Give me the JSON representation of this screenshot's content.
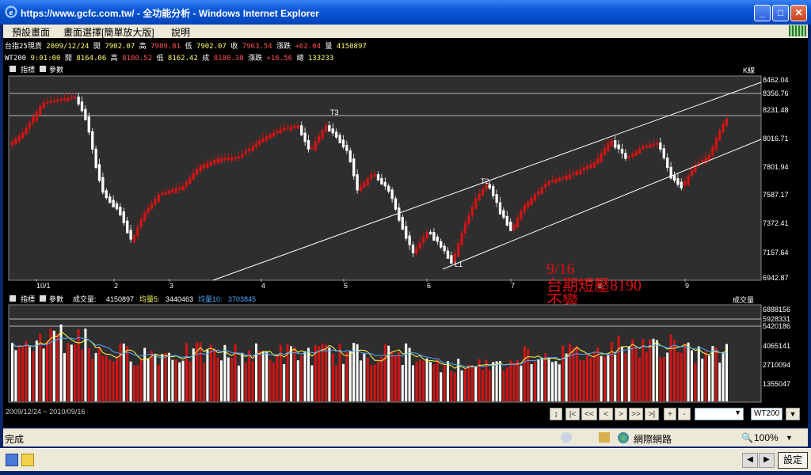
{
  "window": {
    "title": "https://www.gcfc.com.tw/ - 全功能分析 - Windows Internet Explorer",
    "min_label": "_",
    "max_label": "□",
    "close_label": "✕"
  },
  "menu": [
    "預設畫面",
    "畫面選擇[簡單放大版]",
    "說明"
  ],
  "quotes": {
    "row1": {
      "name": "台指25現貨",
      "date": "2009/12/24",
      "open_label": "開",
      "open": "7902.07",
      "high_label": "高",
      "high": "7989.81",
      "low_label": "低",
      "low": "7902.07",
      "close_label": "收",
      "close": "7963.54",
      "chg_label": "漲跌",
      "chg": "+62.04",
      "vol_label": "量",
      "vol": "4150897"
    },
    "row2": {
      "name": "WT200",
      "time": "9:01:00",
      "open_label": "開",
      "open": "8164.06",
      "high_label": "高",
      "high": "8180.52",
      "low_label": "低",
      "low": "8162.42",
      "close_label": "成",
      "close": "8180.38",
      "chg_label": "漲跌",
      "chg": "+16.56",
      "vol_label": "總",
      "vol": "133233"
    }
  },
  "price_panel": {
    "indicator_label": "指標",
    "param_label": "參數",
    "kline_label": "K線",
    "yticks": [
      "8462.04",
      "8356.76",
      "8231.48",
      "8016.71",
      "7801.94",
      "7587.17",
      "7372.41",
      "7157.64",
      "6942.87"
    ],
    "xticks": [
      "10/1",
      "2",
      "3",
      "4",
      "5",
      "6",
      "7",
      "8",
      "9"
    ],
    "points": [
      "T3",
      "T2",
      "L1"
    ],
    "annotation": {
      "line1": "9/16",
      "line2": "台期短壓8190",
      "line3": "不變"
    },
    "colors": {
      "up": "#d01515",
      "down": "#ffffff",
      "bg": "#2e2e2e",
      "annotation": "#e01010"
    }
  },
  "volume_panel": {
    "indicator_label": "指標",
    "param_label": "參數",
    "vol_label": "成交量:",
    "vol_value": "4150897",
    "ma5_label": "均量5:",
    "ma5_value": "3440463",
    "ma10_label": "均量10:",
    "ma10_value": "3703845",
    "unit_label": "成交量",
    "yticks": [
      "6888156",
      "5928331",
      "5420186",
      "4065141",
      "2710094",
      "1355047"
    ]
  },
  "date_range": "2009/12/24 ~ 2010/09/16",
  "nav": {
    "buttons": [
      "↨",
      "|<",
      "<<",
      "<",
      ">",
      ">>",
      ">|",
      "+",
      "-"
    ],
    "symbol": "WT200"
  },
  "status": {
    "text": "完成",
    "zone": "網際網路",
    "zoom": "100%"
  },
  "taskbar": {
    "settings": "設定"
  }
}
